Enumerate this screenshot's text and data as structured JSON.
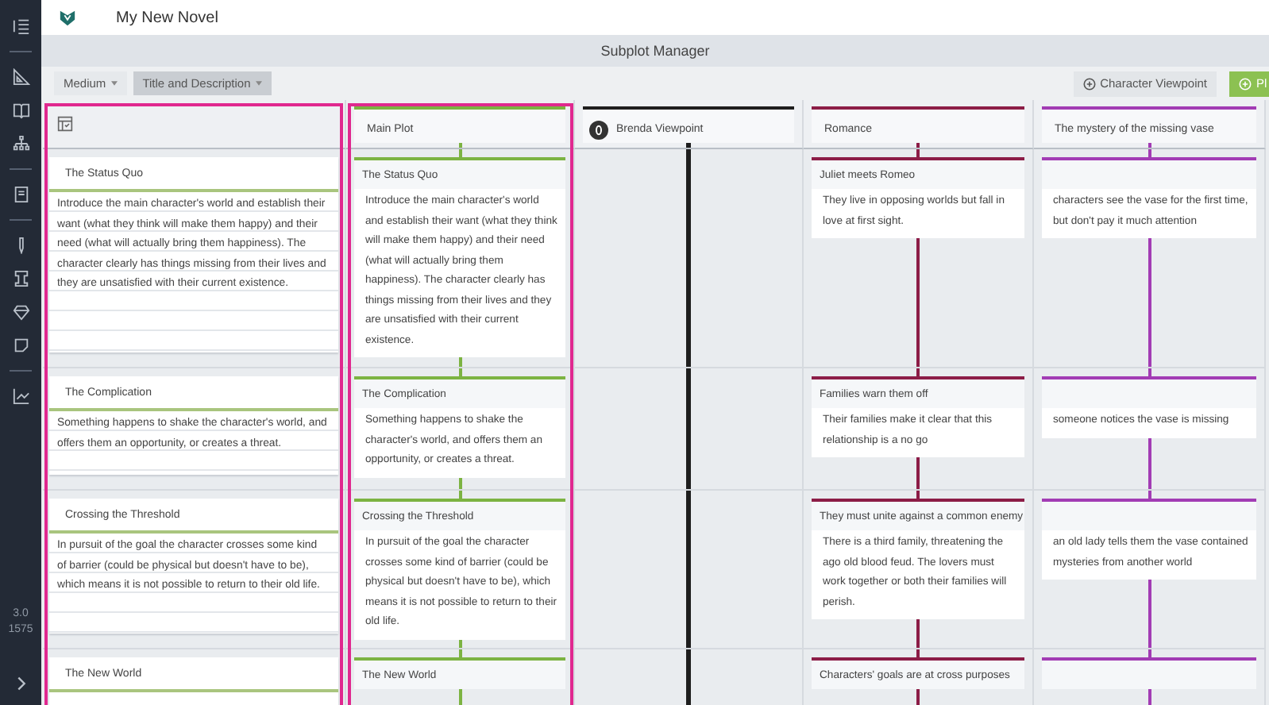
{
  "app": {
    "title": "My New Novel",
    "version": "3.0",
    "build": "1575"
  },
  "header": {
    "title": "Subplot Manager"
  },
  "toolbar": {
    "dropdowns": [
      {
        "label": "Medium",
        "selected": false
      },
      {
        "label": "Title and Description",
        "selected": true
      }
    ],
    "buttons": [
      {
        "label": "Character Viewpoint",
        "kind": "secondary"
      },
      {
        "label": "Pl",
        "kind": "primary"
      }
    ]
  },
  "outline": {
    "selected": true,
    "beats": [
      {
        "title": "The Status Quo",
        "description": "Introduce the main character's world and establish their want (what they think will make them happy) and their need (what will actually bring them happiness). The character clearly has things missing from their lives and they are unsatisfied with their current existence."
      },
      {
        "title": "The Complication",
        "description": "Something happens to shake the character's world, and offers them an opportunity, or creates a threat."
      },
      {
        "title": "Crossing the Threshold",
        "description": "In pursuit of the goal the character crosses some kind of barrier (could be physical but doesn't have to be), which means it is not possible to return to their old life."
      },
      {
        "title": "The New World"
      }
    ]
  },
  "plots": [
    {
      "name": "Main Plot",
      "kind": "plot",
      "color": "#7cb342",
      "selected": true,
      "beats": [
        {
          "kind": "card",
          "title": "The Status Quo",
          "description": "Introduce the main character's world and establish their want (what they think will make them happy) and their need (what will actually bring them happiness). The character clearly has things missing from their lives and they are unsatisfied with their current existence."
        },
        {
          "kind": "card",
          "title": "The Complication",
          "description": "Something happens to shake the character's world, and offers them an opportunity, or creates a threat."
        },
        {
          "kind": "card",
          "title": "Crossing the Threshold",
          "description": "In pursuit of the goal the character crosses some kind of barrier (could be physical but doesn't have to be), which means it is not possible to return to their old life."
        },
        {
          "kind": "card",
          "title": "The New World"
        }
      ]
    },
    {
      "name": "Brenda Viewpoint",
      "kind": "viewpoint",
      "color": "#1e1e1e",
      "selected": false
    },
    {
      "name": "Romance",
      "kind": "plot",
      "color": "#8c1d47",
      "selected": false,
      "beats": [
        {
          "kind": "card",
          "title": "Juliet meets Romeo",
          "description": "They live in opposing worlds but fall in love at first sight."
        },
        {
          "kind": "card",
          "title": "Families warn them off",
          "description": "Their families make it clear that this relationship is a no go"
        },
        {
          "kind": "card",
          "title": "They must unite against a common enemy",
          "description": "There is a third family, threatening the ago old blood feud. The lovers must work together or both their families will perish."
        },
        {
          "kind": "card",
          "title": "Characters' goals are at cross purposes"
        }
      ]
    },
    {
      "name": "The mystery of the missing vase",
      "kind": "plot",
      "color": "#a23cb4",
      "selected": false,
      "beats": [
        {
          "kind": "card",
          "description": "characters see the vase for the first time, but don't pay it much attention"
        },
        {
          "kind": "card",
          "description": "someone notices the vase is missing"
        },
        {
          "kind": "card",
          "description": "an old lady tells them the vase contained mysteries from another world"
        },
        {
          "kind": "card"
        }
      ]
    }
  ]
}
